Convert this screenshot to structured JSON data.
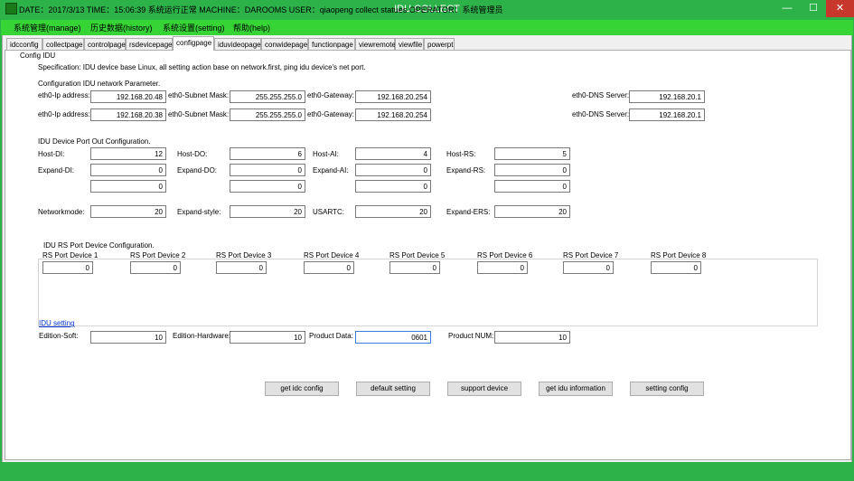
{
  "window": {
    "title": "IDU COLLECT",
    "min": "—",
    "max": "☐",
    "close": "✕"
  },
  "menu": [
    "系统管理(manage)",
    "历史数据(history)",
    "系统设置(setting)",
    "帮助(help)"
  ],
  "tabs": [
    "idcconfig",
    "collectpage",
    "controlpage",
    "rsdevicepage",
    "configpage",
    "iduvideopage",
    "conwidepage",
    "functionpage",
    "viewremote",
    "viewfile",
    "powerpt"
  ],
  "active_tab": "configpage",
  "panel": {
    "group_title": "Config IDU",
    "spec": "Specification: IDU device base Linux, all setting action base on network.first, ping idu device's net port.",
    "network_title": "Configuration IDU network Parameter.",
    "rows": [
      {
        "ip_label": "eth0-Ip address:",
        "ip": "192.168.20.48",
        "mask_label": "eth0-Subnet Mask:",
        "mask": "255.255.255.0",
        "gw_label": "eth0-Gateway:",
        "gw": "192.168.20.254",
        "dns_label": "eth0-DNS Server:",
        "dns": "192.168.20.1"
      },
      {
        "ip_label": "eth0-Ip address:",
        "ip": "192.168.20.38",
        "mask_label": "eth0-Subnet Mask:",
        "mask": "255.255.255.0",
        "gw_label": "eth0-Gateway:",
        "gw": "192.168.20.254",
        "dns_label": "eth0-DNS Server:",
        "dns": "192.168.20.1"
      }
    ],
    "port_title": "IDU Device Port Out Configuration.",
    "ports": {
      "host_di_label": "Host-DI:",
      "host_di": "12",
      "host_do_label": "Host-DO:",
      "host_do": "6",
      "host_ai_label": "Host-AI:",
      "host_ai": "4",
      "host_rs_label": "Host-RS:",
      "host_rs": "5",
      "exp_di_label": "Expand-DI:",
      "exp_di": "0",
      "exp_do_label": "Expand-DO:",
      "exp_do": "0",
      "exp_ai_label": "Expand-AI:",
      "exp_ai": "0",
      "exp_rs_label": "Expand-RS:",
      "exp_rs": "0",
      "extra_di": "0",
      "extra_do": "0",
      "extra_ai": "0",
      "extra_rs": "0",
      "netmode_label": "Networkmode:",
      "netmode": "20",
      "expstyle_label": "Expand-style:",
      "expstyle": "20",
      "usartc_label": "USARTC:",
      "usartc": "20",
      "experss_label": "Expand-ERS:",
      "experss": "20"
    },
    "rs_title": "IDU RS Port Device Configuration.",
    "rs_devices": [
      {
        "label": "RS Port Device 1",
        "value": "0"
      },
      {
        "label": "RS Port Device 2",
        "value": "0"
      },
      {
        "label": "RS Port Device 3",
        "value": "0"
      },
      {
        "label": "RS Port Device 4",
        "value": "0"
      },
      {
        "label": "RS Port Device 5",
        "value": "0"
      },
      {
        "label": "RS Port Device 6",
        "value": "0"
      },
      {
        "label": "RS Port Device 7",
        "value": "0"
      },
      {
        "label": "RS Port Device 8",
        "value": "0"
      }
    ],
    "idu_setting_link": "IDU setting",
    "edition": {
      "soft_label": "Edition-Soft:",
      "soft": "10",
      "hw_label": "Edition-Hardware:",
      "hw": "10",
      "pdata_label": "Product Data:",
      "pdata": "0601",
      "pnum_label": "Product NUM:",
      "pnum": "10"
    },
    "buttons": [
      "get idc config",
      "default setting",
      "support device",
      "get idu information",
      "setting config"
    ]
  },
  "status": "DATE：2017/3/13  TIME：15:06:39  系统运行正常  MACHINE：DAROOMS  USER：qiaopeng  collect statues  OPERATOR：系统管理员",
  "colors": {
    "titlebar": "#2db24a",
    "menubar": "#37d436",
    "close": "#c7372c"
  }
}
